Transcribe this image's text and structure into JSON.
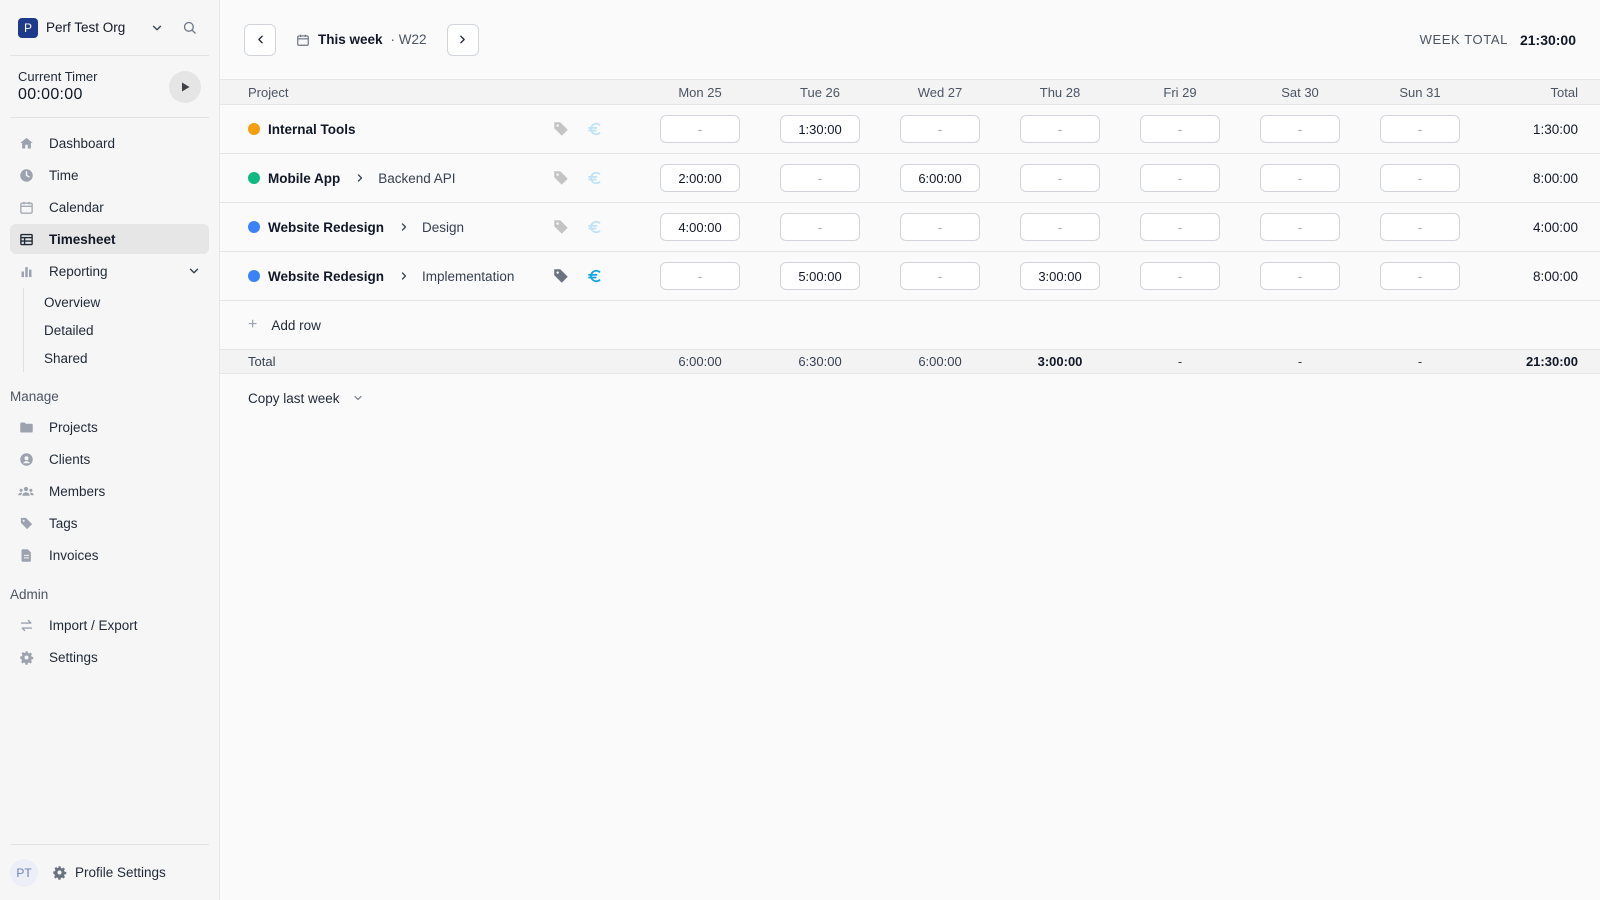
{
  "sidebar": {
    "org_initial": "P",
    "org_name": "Perf Test Org",
    "timer_label": "Current Timer",
    "timer_value": "00:00:00",
    "nav": [
      {
        "label": "Dashboard"
      },
      {
        "label": "Time"
      },
      {
        "label": "Calendar"
      },
      {
        "label": "Timesheet"
      },
      {
        "label": "Reporting"
      }
    ],
    "reporting_sub": [
      {
        "label": "Overview"
      },
      {
        "label": "Detailed"
      },
      {
        "label": "Shared"
      }
    ],
    "manage_title": "Manage",
    "manage": [
      {
        "label": "Projects"
      },
      {
        "label": "Clients"
      },
      {
        "label": "Members"
      },
      {
        "label": "Tags"
      },
      {
        "label": "Invoices"
      }
    ],
    "admin_title": "Admin",
    "admin": [
      {
        "label": "Import / Export"
      },
      {
        "label": "Settings"
      }
    ],
    "profile_initials": "PT",
    "profile_label": "Profile Settings"
  },
  "topbar": {
    "this_week": "This week",
    "week_num": "· W22",
    "week_total_label": "WEEK TOTAL",
    "week_total_value": "21:30:00"
  },
  "table": {
    "project_header": "Project",
    "days": [
      "Mon 25",
      "Tue 26",
      "Wed 27",
      "Thu 28",
      "Fri 29",
      "Sat 30",
      "Sun 31"
    ],
    "total_header": "Total",
    "rows": [
      {
        "project": "Internal Tools",
        "task": "",
        "color": "#f59e0b",
        "values": [
          "-",
          "1:30:00",
          "-",
          "-",
          "-",
          "-",
          "-"
        ],
        "total": "1:30:00"
      },
      {
        "project": "Mobile App",
        "task": "Backend API",
        "color": "#10b981",
        "values": [
          "2:00:00",
          "-",
          "6:00:00",
          "-",
          "-",
          "-",
          "-"
        ],
        "total": "8:00:00"
      },
      {
        "project": "Website Redesign",
        "task": "Design",
        "color": "#3b82f6",
        "values": [
          "4:00:00",
          "-",
          "-",
          "-",
          "-",
          "-",
          "-"
        ],
        "total": "4:00:00"
      },
      {
        "project": "Website Redesign",
        "task": "Implementation",
        "color": "#3b82f6",
        "values": [
          "-",
          "5:00:00",
          "-",
          "3:00:00",
          "-",
          "-",
          "-"
        ],
        "total": "8:00:00"
      }
    ],
    "add_row": "Add row",
    "total_label": "Total",
    "day_totals": [
      "6:00:00",
      "6:30:00",
      "6:00:00",
      "3:00:00",
      "-",
      "-",
      "-"
    ],
    "grand_total": "21:30:00"
  },
  "copy_last_week": "Copy last week",
  "colors": {
    "accent": "#1e3a8a",
    "billable_active": "#0ea5e9",
    "billable_inactive": "#bfe3f5",
    "tag_active": "#6b7280",
    "tag_inactive": "#c4c4c4"
  }
}
